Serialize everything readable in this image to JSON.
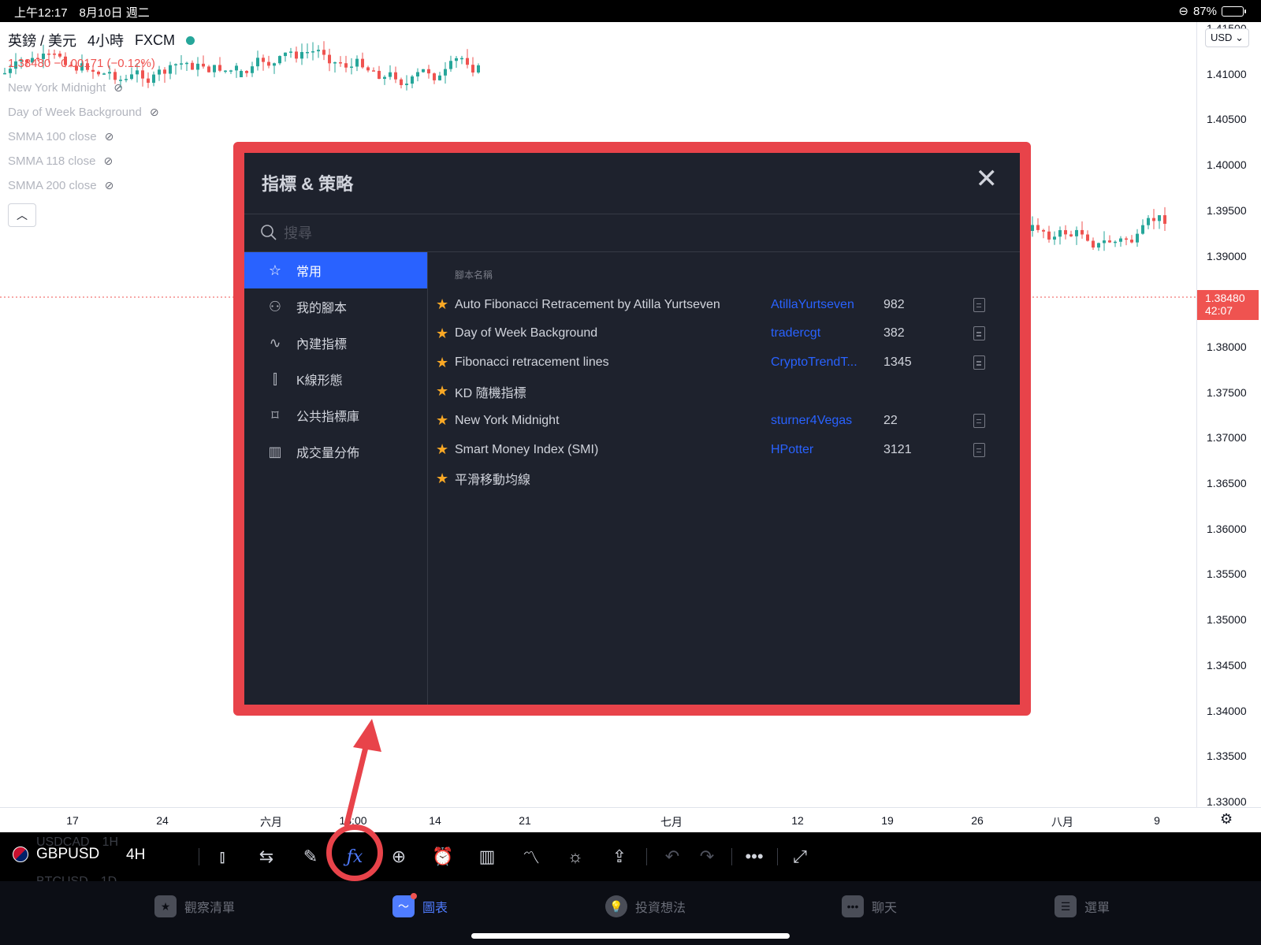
{
  "status_bar": {
    "time": "上午12:17　8月10日 週二",
    "battery": "87%"
  },
  "chart": {
    "symbol_name": "英鎊 / 美元",
    "interval": "4小時",
    "exchange": "FXCM",
    "price_line": "1.38480 −0.00171 (−0.12%)",
    "indicators": [
      "New York Midnight",
      "Day of Week Background",
      "SMMA 100 close",
      "SMMA 118 close",
      "SMMA 200 close"
    ],
    "currency": "USD",
    "price_ticks": [
      "1.41500",
      "1.41000",
      "1.40500",
      "1.40000",
      "1.39500",
      "1.39000",
      "1.38500",
      "1.38000",
      "1.37500",
      "1.37000",
      "1.36500",
      "1.36000",
      "1.35500",
      "1.35000",
      "1.34500",
      "1.34000",
      "1.33500",
      "1.33000"
    ],
    "last_price": "1.38480",
    "countdown": "42:07",
    "time_ticks": [
      "17",
      "24",
      "六月",
      "13:00",
      "14",
      "21",
      "七月",
      "12",
      "19",
      "26",
      "八月",
      "9"
    ]
  },
  "toolbar": {
    "symbol": "GBPUSD",
    "timeframe": "4H",
    "ghost_above": "USDCAD　1H",
    "ghost_below": "BTCUSD　1D"
  },
  "dialog": {
    "title": "指標 & 策略",
    "search_placeholder": "搜尋",
    "categories": [
      {
        "label": "常用",
        "icon": "star-icon",
        "active": true
      },
      {
        "label": "我的腳本",
        "icon": "user-icon",
        "active": false
      },
      {
        "label": "內建指標",
        "icon": "chart-line-icon",
        "active": false
      },
      {
        "label": "K線形態",
        "icon": "candlestick-icon",
        "active": false
      },
      {
        "label": "公共指標庫",
        "icon": "bookmark-icon",
        "active": false
      },
      {
        "label": "成交量分佈",
        "icon": "bar-chart-icon",
        "active": false
      }
    ],
    "list_header": "腳本名稱",
    "scripts": [
      {
        "name": "Auto Fibonacci Retracement by Atilla Yurtseven",
        "author": "AtillaYurtseven",
        "count": "982",
        "doc": true
      },
      {
        "name": "Day of Week Background",
        "author": "tradercgt",
        "count": "382",
        "doc": true
      },
      {
        "name": "Fibonacci retracement lines",
        "author": "CryptoTrendT...",
        "count": "1345",
        "doc": true
      },
      {
        "name": "KD 隨機指標",
        "author": "",
        "count": "",
        "doc": false
      },
      {
        "name": "New York Midnight",
        "author": "sturner4Vegas",
        "count": "22",
        "doc": true
      },
      {
        "name": "Smart Money Index (SMI)",
        "author": "HPotter",
        "count": "3121",
        "doc": true
      },
      {
        "name": "平滑移動均線",
        "author": "",
        "count": "",
        "doc": false
      }
    ]
  },
  "tabs": [
    {
      "label": "觀察清單",
      "icon": "star-icon",
      "active": false
    },
    {
      "label": "圖表",
      "icon": "chart-icon",
      "active": true
    },
    {
      "label": "投資想法",
      "icon": "lightbulb-icon",
      "active": false
    },
    {
      "label": "聊天",
      "icon": "chat-icon",
      "active": false
    },
    {
      "label": "選單",
      "icon": "menu-icon",
      "active": false
    }
  ],
  "colors": {
    "accent": "#2962ff",
    "up": "#26a69a",
    "down": "#ef5350",
    "highlight": "#e8434a",
    "dialog_bg": "#1e222d"
  }
}
